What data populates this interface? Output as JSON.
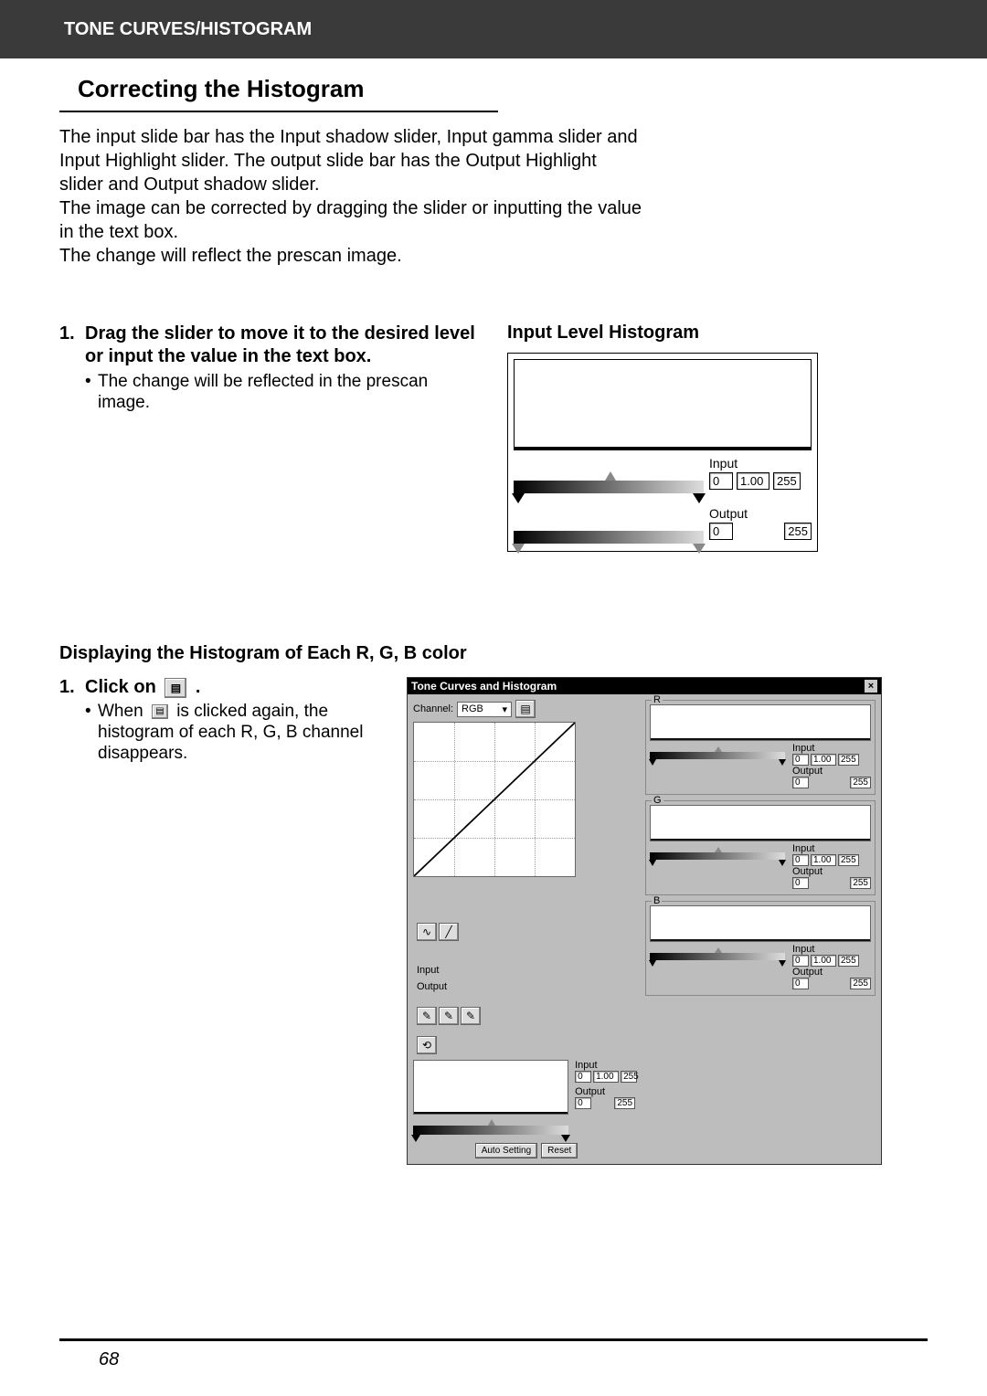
{
  "header": "TONE CURVES/HISTOGRAM",
  "section_title": "Correcting the Histogram",
  "intro_p1": "The input slide bar has the Input shadow slider, Input gamma slider and Input Highlight slider. The output slide bar has the Output Highlight slider and Output shadow slider.",
  "intro_p2": "The image can be corrected by dragging the slider or inputting the value in the text box.",
  "intro_p3": "The change will reflect the prescan image.",
  "step1_num": "1.",
  "step1_text": "Drag the slider to move it to the desired level or input the value in the text box.",
  "step1_bullet": "The change will be reflected in the prescan image.",
  "right_title": "Input Level Histogram",
  "histo": {
    "input_label": "Input",
    "output_label": "Output",
    "input_vals": [
      "0",
      "1.00",
      "255"
    ],
    "output_vals": [
      "0",
      "255"
    ]
  },
  "sub_heading": "Displaying the Histogram of Each R, G, B color",
  "step2_num": "1.",
  "step2_text_prefix": "Click on ",
  "step2_text_suffix": ".",
  "step2_bullet_prefix": "When ",
  "step2_bullet_suffix": " is clicked again, the histogram of each R, G, B channel disappears.",
  "icon_name": "rgb-histogram-icon",
  "dialog": {
    "title": "Tone Curves and Histogram",
    "channel_label": "Channel:",
    "channel_value": "RGB",
    "input_label": "Input",
    "output_label": "Output",
    "auto_btn": "Auto Setting",
    "reset_btn": "Reset",
    "vals_in": [
      "0",
      "1.00",
      "255"
    ],
    "vals_out": [
      "0",
      "255"
    ],
    "channels": [
      {
        "letter": "R",
        "in": [
          "0",
          "1.00",
          "255"
        ],
        "out": [
          "0",
          "255"
        ]
      },
      {
        "letter": "G",
        "in": [
          "0",
          "1.00",
          "255"
        ],
        "out": [
          "0",
          "255"
        ]
      },
      {
        "letter": "B",
        "in": [
          "0",
          "1.00",
          "255"
        ],
        "out": [
          "0",
          "255"
        ]
      }
    ]
  },
  "page_number": "68",
  "bullet_char": "•"
}
